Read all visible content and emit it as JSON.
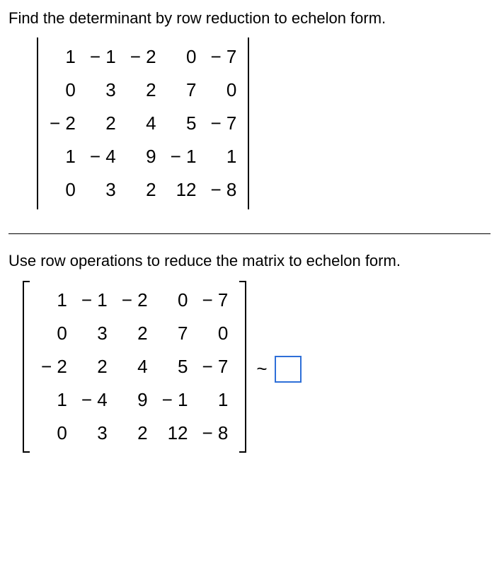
{
  "question": {
    "prompt": "Find the determinant by row reduction to echelon form.",
    "matrix": [
      [
        "1",
        "− 1",
        "− 2",
        "0",
        "− 7"
      ],
      [
        "0",
        "3",
        "2",
        "7",
        "0"
      ],
      [
        "− 2",
        "2",
        "4",
        "5",
        "− 7"
      ],
      [
        "1",
        "− 4",
        "9",
        "− 1",
        "1"
      ],
      [
        "0",
        "3",
        "2",
        "12",
        "− 8"
      ]
    ]
  },
  "instruction": "Use row operations to reduce the matrix to echelon form.",
  "echelon": {
    "matrix": [
      [
        "1",
        "− 1",
        "− 2",
        "0",
        "− 7"
      ],
      [
        "0",
        "3",
        "2",
        "7",
        "0"
      ],
      [
        "− 2",
        "2",
        "4",
        "5",
        "− 7"
      ],
      [
        "1",
        "− 4",
        "9",
        "− 1",
        "1"
      ],
      [
        "0",
        "3",
        "2",
        "12",
        "− 8"
      ]
    ],
    "relation": "~"
  },
  "chart_data": {
    "type": "table",
    "title": "5x5 matrix for determinant by row reduction",
    "rows": 5,
    "cols": 5,
    "values": [
      [
        1,
        -1,
        -2,
        0,
        -7
      ],
      [
        0,
        3,
        2,
        7,
        0
      ],
      [
        -2,
        2,
        4,
        5,
        -7
      ],
      [
        1,
        -4,
        9,
        -1,
        1
      ],
      [
        0,
        3,
        2,
        12,
        -8
      ]
    ]
  }
}
